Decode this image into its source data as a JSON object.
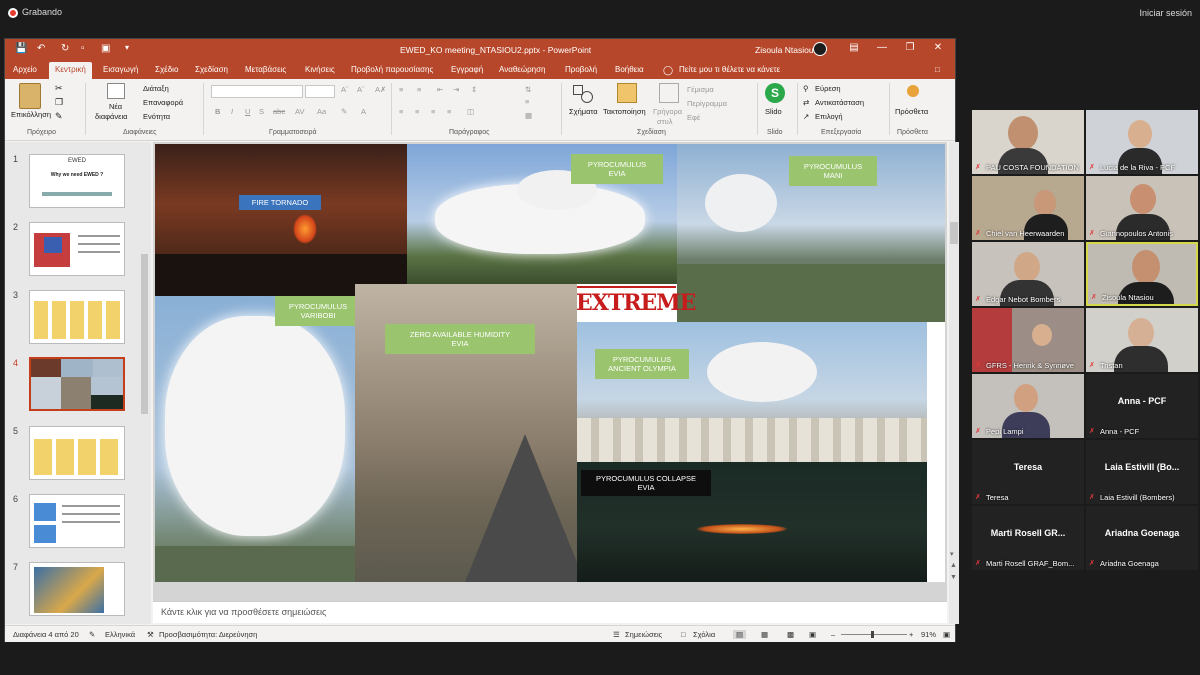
{
  "recording": {
    "label": "Grabando",
    "exit_label": "Iniciar sesión"
  },
  "window": {
    "title": "EWED_KO meeting_NTASIOU2.pptx - PowerPoint",
    "user": "Zisoula Ntasiou",
    "accent": "#b7472a"
  },
  "tabs": [
    "Αρχείο",
    "Κεντρική",
    "Εισαγωγή",
    "Σχέδιο",
    "Σχεδίαση",
    "Μεταβάσεις",
    "Κινήσεις",
    "Προβολή παρουσίασης",
    "Εγγραφή",
    "Αναθεώρηση",
    "Προβολή",
    "Βοήθεια"
  ],
  "active_tab": "Κεντρική",
  "tell_me": "Πείτε μου τι θέλετε να κάνετε",
  "ribbon": {
    "paste": "Επικόλληση",
    "new_slide_1": "Νέα",
    "new_slide_2": "διαφάνεια",
    "layout": "Διάταξη",
    "reset": "Επαναφορά",
    "section": "Ενότητα",
    "shapes": "Σχήματα",
    "arrange": "Τακτοποίηση",
    "quick_styles_1": "Γρήγορα",
    "quick_styles_2": "στυλ",
    "fill": "Γέμισμα",
    "outline": "Περίγραμμα",
    "effects": "Εφέ",
    "slido": "Slido",
    "find": "Εύρεση",
    "replace": "Αντικατάσταση",
    "select": "Επιλογή",
    "addins": "Πρόσθετα",
    "groups": {
      "clipboard": "Πρόχειρο",
      "slides": "Διαφάνειες",
      "font": "Γραμματοσειρά",
      "paragraph": "Παράγραφος",
      "drawing": "Σχεδίαση",
      "slido": "Slido",
      "editing": "Επεξεργασία",
      "addins": "Πρόσθετα"
    }
  },
  "thumbnails": [
    {
      "num": "1",
      "title": "EWED",
      "subtitle": "Why we need EWED ?"
    },
    {
      "num": "2"
    },
    {
      "num": "3"
    },
    {
      "num": "4"
    },
    {
      "num": "5"
    },
    {
      "num": "6"
    },
    {
      "num": "7"
    }
  ],
  "selected_slide": 4,
  "slide_labels": {
    "fire_tornado": "FIRE TORNADO",
    "pyro_evia_1": "PYROCUMULUS",
    "pyro_evia_2": "EVIA",
    "pyro_mani_1": "PYROCUMULUS",
    "pyro_mani_2": "MANI",
    "pyro_varibobi_1": "PYROCUMULUS",
    "pyro_varibobi_2": "VARIBOBI",
    "zero_humidity_1": "ZERO AVAILABLE HUMIDITY",
    "zero_humidity_2": "EVIA",
    "extreme": "EXTREME",
    "olympia_1": "PYROCUMULUS",
    "olympia_2": "ANCIENT OLYMPIA",
    "collapse_1": "PYROCUMULUS COLLAPSE",
    "collapse_2": "EVIA"
  },
  "notes_placeholder": "Κάντε κλικ για να προσθέσετε σημειώσεις",
  "status": {
    "slide_counter": "Διαφάνεια 4 από 20",
    "language": "Ελληνικά",
    "accessibility": "Προσβασιμότητα: Διερεύνηση",
    "notes": "Σημειώσεις",
    "comments": "Σχόλια",
    "zoom": "91%"
  },
  "participants": [
    {
      "name": "PAU COSTA FOUNDATION",
      "video": true
    },
    {
      "name": "Lucia de la Riva - PCF",
      "video": true
    },
    {
      "name": "Chiel van Heerwaarden",
      "video": true
    },
    {
      "name": "Giannopoulos Antonis",
      "video": true
    },
    {
      "name": "Edgar Nebot Bombers",
      "video": true
    },
    {
      "name": "Zisoula Ntasiou",
      "video": true
    },
    {
      "name": "GFRS - Henrik & Synnøve",
      "video": true
    },
    {
      "name": "Tristan",
      "video": true
    },
    {
      "name": "Pepi Lampi",
      "video": true
    },
    {
      "name": "Anna - PCF",
      "video": false,
      "display": "Anna - PCF"
    },
    {
      "name": "Teresa",
      "video": false,
      "display": "Teresa"
    },
    {
      "name": "Laia Estivill (Bombers)",
      "video": false,
      "display": "Laia Estivill (Bo..."
    },
    {
      "name": "Marti Rosell GRAF_Bom...",
      "video": false,
      "display": "Marti Rosell GR..."
    },
    {
      "name": "Ariadna Goenaga",
      "video": false,
      "display": "Ariadna Goenaga"
    }
  ]
}
